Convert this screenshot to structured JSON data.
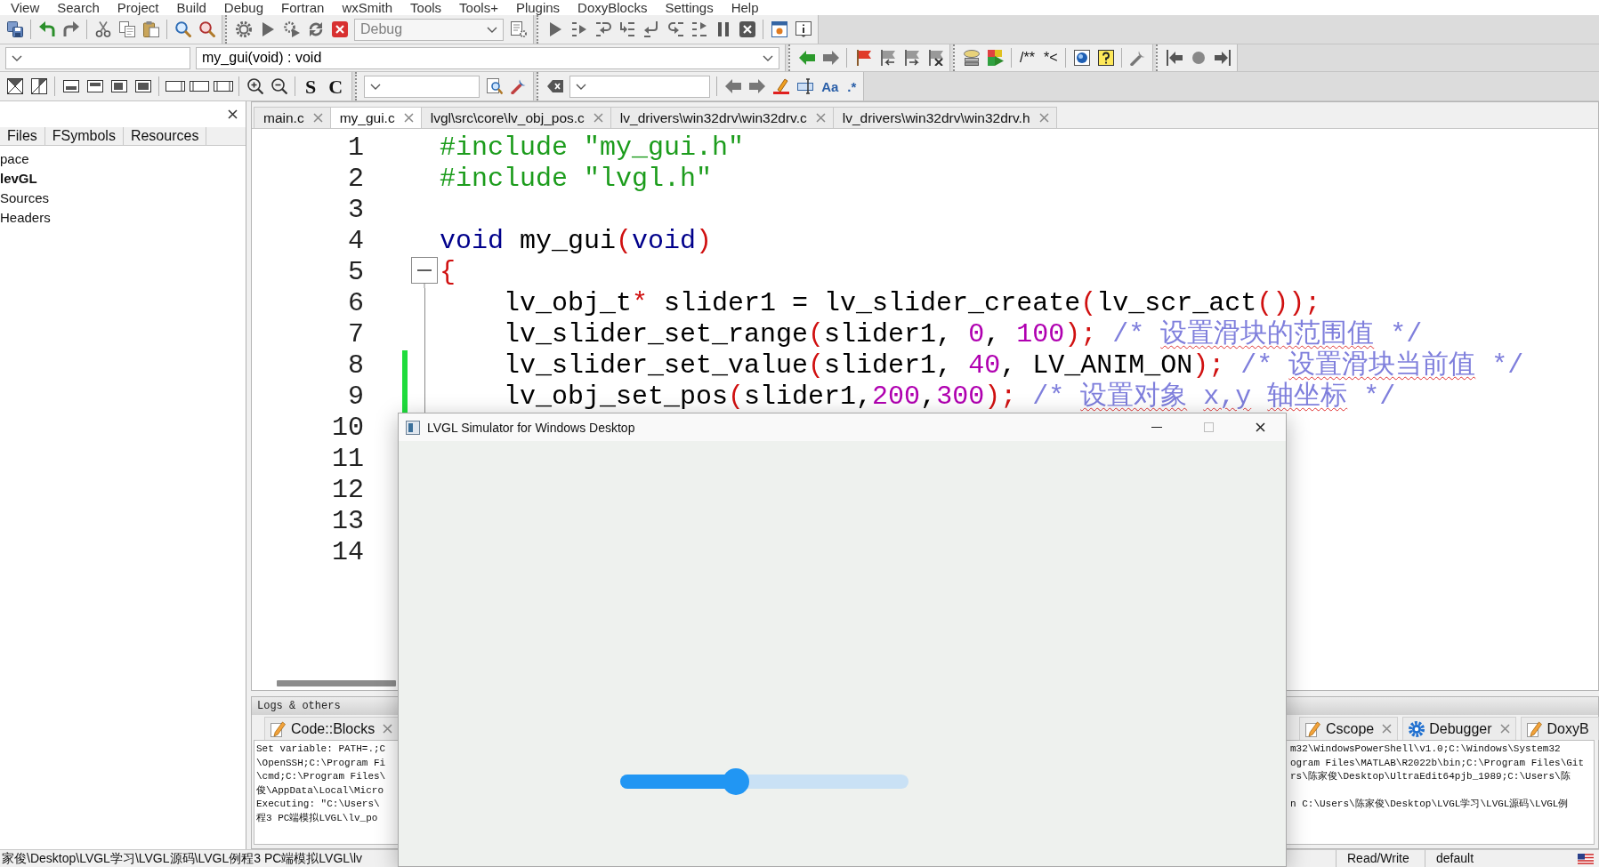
{
  "menu": [
    "View",
    "Search",
    "Project",
    "Build",
    "Debug",
    "Fortran",
    "wxSmith",
    "Tools",
    "Tools+",
    "Plugins",
    "DoxyBlocks",
    "Settings",
    "Help"
  ],
  "toolbar": {
    "build_target": {
      "value": "Debug",
      "disabled": true
    },
    "function_scope": "my_gui(void) : void",
    "code_style_buttons": [
      "S",
      "C"
    ],
    "comment_buttons": [
      "/**",
      "*<"
    ],
    "search_option_buttons": [
      "Aa",
      ".*"
    ]
  },
  "management_panel": {
    "tabs": [
      {
        "label": "Files",
        "selected": false
      },
      {
        "label": "FSymbols",
        "selected": false
      },
      {
        "label": "Resources",
        "selected": false
      }
    ],
    "tree": [
      {
        "label": "pace",
        "active": false,
        "children": [
          {
            "label": "levGL",
            "active": true,
            "children": [
              {
                "label": "Sources",
                "active": false
              },
              {
                "label": "Headers",
                "active": false
              }
            ]
          }
        ]
      }
    ]
  },
  "editor": {
    "tabs": [
      {
        "label": "main.c",
        "selected": false
      },
      {
        "label": "my_gui.c",
        "selected": true
      },
      {
        "label": "lvgl\\src\\core\\lv_obj_pos.c",
        "selected": false
      },
      {
        "label": "lv_drivers\\win32drv\\win32drv.c",
        "selected": false
      },
      {
        "label": "lv_drivers\\win32drv\\win32drv.h",
        "selected": false
      }
    ],
    "lines": [
      {
        "number": "1",
        "changed": false,
        "fold_start": false,
        "in_fold": false,
        "tokens": [
          {
            "kind": "directive",
            "text": "#include "
          },
          {
            "kind": "string",
            "text": "\"my_gui.h\""
          }
        ]
      },
      {
        "number": "2",
        "changed": false,
        "fold_start": false,
        "in_fold": false,
        "tokens": [
          {
            "kind": "directive",
            "text": "#include "
          },
          {
            "kind": "string",
            "text": "\"lvgl.h\""
          }
        ]
      },
      {
        "number": "3",
        "changed": false,
        "fold_start": false,
        "in_fold": false
      },
      {
        "number": "4",
        "changed": false,
        "fold_start": false,
        "in_fold": false,
        "tokens": [
          {
            "kind": "keyword",
            "text": "void"
          },
          {
            "kind": "plain",
            "text": " my_gui"
          },
          {
            "kind": "operator",
            "text": "("
          },
          {
            "kind": "keyword",
            "text": "void"
          },
          {
            "kind": "operator",
            "text": ")"
          }
        ]
      },
      {
        "number": "5",
        "changed": false,
        "fold_start": true,
        "in_fold": false,
        "tokens": [
          {
            "kind": "operator",
            "text": "{"
          }
        ]
      },
      {
        "number": "6",
        "changed": false,
        "fold_start": false,
        "in_fold": true,
        "tokens": [
          {
            "kind": "plain",
            "text": "    lv_obj_t"
          },
          {
            "kind": "operator",
            "text": "*"
          },
          {
            "kind": "plain",
            "text": " slider1 = lv_slider_create"
          },
          {
            "kind": "operator",
            "text": "("
          },
          {
            "kind": "plain",
            "text": "lv_scr_act"
          },
          {
            "kind": "operator",
            "text": "());"
          }
        ]
      },
      {
        "number": "7",
        "changed": false,
        "fold_start": false,
        "in_fold": true,
        "tokens": [
          {
            "kind": "plain",
            "text": "    lv_slider_set_range"
          },
          {
            "kind": "operator",
            "text": "("
          },
          {
            "kind": "plain",
            "text": "slider1, "
          },
          {
            "kind": "number",
            "text": "0"
          },
          {
            "kind": "plain",
            "text": ", "
          },
          {
            "kind": "number",
            "text": "100"
          },
          {
            "kind": "operator",
            "text": ");"
          },
          {
            "kind": "comment",
            "text": " /* "
          },
          {
            "kind": "misspelled",
            "text": "设置滑块的范围值"
          },
          {
            "kind": "comment",
            "text": " */"
          }
        ]
      },
      {
        "number": "8",
        "changed": true,
        "fold_start": false,
        "in_fold": true,
        "tokens": [
          {
            "kind": "plain",
            "text": "    lv_slider_set_value"
          },
          {
            "kind": "operator",
            "text": "("
          },
          {
            "kind": "plain",
            "text": "slider1, "
          },
          {
            "kind": "number",
            "text": "40"
          },
          {
            "kind": "plain",
            "text": ", LV_ANIM_ON"
          },
          {
            "kind": "operator",
            "text": ");"
          },
          {
            "kind": "comment",
            "text": " /* "
          },
          {
            "kind": "misspelled",
            "text": "设置滑块当前值"
          },
          {
            "kind": "comment",
            "text": " */"
          }
        ]
      },
      {
        "number": "9",
        "changed": true,
        "fold_start": false,
        "in_fold": true,
        "tokens": [
          {
            "kind": "plain",
            "text": "    lv_obj_set_pos"
          },
          {
            "kind": "operator",
            "text": "("
          },
          {
            "kind": "plain",
            "text": "slider1,"
          },
          {
            "kind": "number",
            "text": "200"
          },
          {
            "kind": "plain",
            "text": ","
          },
          {
            "kind": "number",
            "text": "300"
          },
          {
            "kind": "operator",
            "text": ");"
          },
          {
            "kind": "comment",
            "text": " /* "
          },
          {
            "kind": "misspelled",
            "text": "设置对象 "
          },
          {
            "kind": "misspelled",
            "text": "x,y "
          },
          {
            "kind": "misspelled",
            "text": "轴坐标"
          },
          {
            "kind": "comment",
            "text": " */"
          }
        ]
      },
      {
        "number": "10",
        "changed": false,
        "fold_start": false,
        "in_fold": false
      },
      {
        "number": "11",
        "changed": false,
        "fold_start": false,
        "in_fold": false
      },
      {
        "number": "12",
        "changed": false,
        "fold_start": false,
        "in_fold": false
      },
      {
        "number": "13",
        "changed": false,
        "fold_start": false,
        "in_fold": false
      },
      {
        "number": "14",
        "changed": false,
        "fold_start": false,
        "in_fold": false
      }
    ]
  },
  "logs": {
    "title": "Logs & others",
    "tabs_left": [
      {
        "label": "Code::Blocks",
        "kind": "log",
        "selected": false
      }
    ],
    "tabs_right": [
      {
        "label": "Cscope",
        "kind": "log",
        "selected": false
      },
      {
        "label": "Debugger",
        "kind": "debugger",
        "selected": false
      },
      {
        "label": "DoxyB",
        "kind": "log",
        "selected": false
      }
    ],
    "lines": [
      {
        "left": "Set variable: PATH=.;C",
        "right": "m32\\WindowsPowerShell\\v1.0;C:\\Windows\\System32"
      },
      {
        "left": "\\OpenSSH;C:\\Program Fi",
        "right": "ogram Files\\MATLAB\\R2022b\\bin;C:\\Program Files\\Git"
      },
      {
        "left": "\\cmd;C:\\Program Files\\",
        "right": "rs\\陈家俊\\Desktop\\UltraEdit64pjb_1989;C:\\Users\\陈"
      },
      {
        "left": "俊\\AppData\\Local\\Micro"
      },
      {
        "left": "Executing: \"C:\\Users\\",
        "right": "n C:\\Users\\陈家俊\\Desktop\\LVGL学习\\LVGL源码\\LVGL例"
      },
      {
        "left": "程3 PC端模拟LVGL\\lv_po"
      }
    ]
  },
  "status_bar": {
    "segments": [
      "家俊\\Desktop\\LVGL学习\\LVGL源码\\LVGL例程3 PC端模拟LVGL\\lv",
      "Read/Write",
      "default"
    ]
  },
  "simulator_window": {
    "title": "LVGL Simulator for Windows Desktop",
    "maximize_disabled": true,
    "slider": {
      "level": 0.4
    }
  }
}
